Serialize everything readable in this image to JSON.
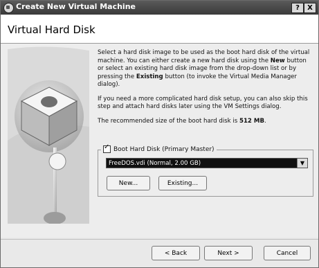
{
  "window": {
    "title": "Create New Virtual Machine",
    "help_button": "?",
    "close_button": "X"
  },
  "header": {
    "title": "Virtual Hard Disk"
  },
  "body": {
    "para1_a": "Select a hard disk image to be used as the boot hard disk of the virtual machine. You can either create a new hard disk using the ",
    "para1_new": "New",
    "para1_b": " button or select an existing hard disk image from the drop-down list or by pressing the ",
    "para1_existing": "Existing",
    "para1_c": " button (to invoke the Virtual Media Manager dialog).",
    "para2": "If you need a more complicated hard disk setup, you can also skip this step and attach hard disks later using the VM Settings dialog.",
    "para3_a": "The recommended size of the boot hard disk is ",
    "para3_size": "512 MB",
    "para3_b": "."
  },
  "boot_disk": {
    "group_label": "Boot Hard Disk (Primary Master)",
    "checked": true,
    "selected_disk": "FreeDOS.vdi (Normal, 2.00 GB)",
    "new_button": "New...",
    "existing_button": "Existing..."
  },
  "footer": {
    "back_button": "< Back",
    "next_button": "Next >",
    "cancel_button": "Cancel"
  }
}
